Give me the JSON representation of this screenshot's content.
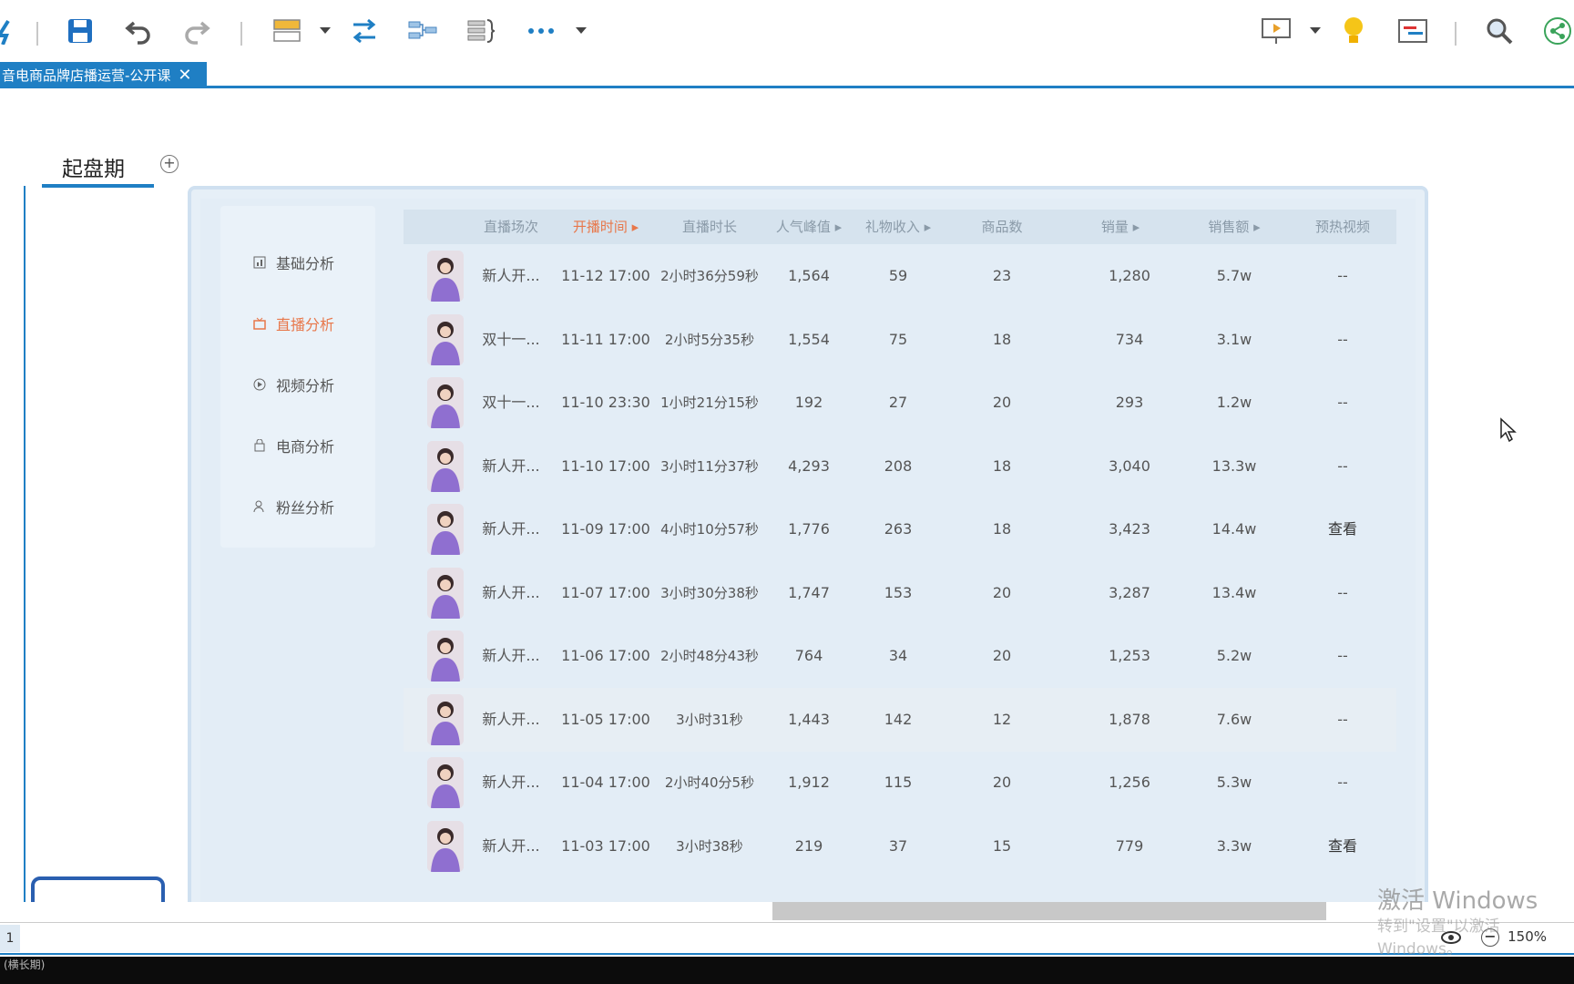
{
  "toolbar": {
    "icons": [
      "app-icon",
      "save-icon",
      "undo-icon",
      "redo-icon",
      "layout-icon",
      "relationship-icon",
      "summary-icon",
      "boundary-icon",
      "more-icon",
      "presentation-icon",
      "idea-icon",
      "gantt-icon",
      "search-icon",
      "share-icon"
    ]
  },
  "tab": {
    "title": "音电商品牌店播运营-公开课",
    "close": "✕"
  },
  "topic": {
    "title": "起盘期",
    "plus": "+"
  },
  "menu": {
    "items": [
      {
        "label": "基础分析",
        "icon": "chart-icon",
        "active": false
      },
      {
        "label": "直播分析",
        "icon": "live-icon",
        "active": true
      },
      {
        "label": "视频分析",
        "icon": "play-icon",
        "active": false
      },
      {
        "label": "电商分析",
        "icon": "bag-icon",
        "active": false
      },
      {
        "label": "粉丝分析",
        "icon": "user-icon",
        "active": false
      }
    ]
  },
  "table": {
    "headers": [
      "直播场次",
      "开播时间",
      "直播时长",
      "人气峰值",
      "礼物收入",
      "商品数",
      "销量",
      "销售额",
      "预热视频"
    ],
    "sort_marks": [
      false,
      true,
      false,
      true,
      true,
      false,
      true,
      true,
      false
    ],
    "active_header": 1,
    "rows": [
      [
        "新人开...",
        "11-12 17:00",
        "2小时36分59秒",
        "1,564",
        "59",
        "23",
        "1,280",
        "5.7w",
        "--"
      ],
      [
        "双十一...",
        "11-11 17:00",
        "2小时5分35秒",
        "1,554",
        "75",
        "18",
        "734",
        "3.1w",
        "--"
      ],
      [
        "双十一...",
        "11-10 23:30",
        "1小时21分15秒",
        "192",
        "27",
        "20",
        "293",
        "1.2w",
        "--"
      ],
      [
        "新人开...",
        "11-10 17:00",
        "3小时11分37秒",
        "4,293",
        "208",
        "18",
        "3,040",
        "13.3w",
        "--"
      ],
      [
        "新人开...",
        "11-09 17:00",
        "4小时10分57秒",
        "1,776",
        "263",
        "18",
        "3,423",
        "14.4w",
        "查看"
      ],
      [
        "新人开...",
        "11-07 17:00",
        "3小时30分38秒",
        "1,747",
        "153",
        "20",
        "3,287",
        "13.4w",
        "--"
      ],
      [
        "新人开...",
        "11-06 17:00",
        "2小时48分43秒",
        "764",
        "34",
        "20",
        "1,253",
        "5.2w",
        "--"
      ],
      [
        "新人开...",
        "11-05 17:00",
        "3小时31秒",
        "1,443",
        "142",
        "12",
        "1,878",
        "7.6w",
        "--"
      ],
      [
        "新人开...",
        "11-04 17:00",
        "2小时40分5秒",
        "1,912",
        "115",
        "20",
        "1,256",
        "5.3w",
        "--"
      ],
      [
        "新人开...",
        "11-03 17:00",
        "3小时38秒",
        "219",
        "37",
        "15",
        "779",
        "3.3w",
        "查看"
      ]
    ]
  },
  "status": {
    "sheet": "1",
    "zoom": "150%",
    "bottom_label": "(横长期)"
  },
  "watermark": {
    "line1": "激活 Windows",
    "line2": "转到\"设置\"以激活 Windows。"
  },
  "colors": {
    "accent": "#1f7fc4",
    "active": "#e8774a"
  }
}
